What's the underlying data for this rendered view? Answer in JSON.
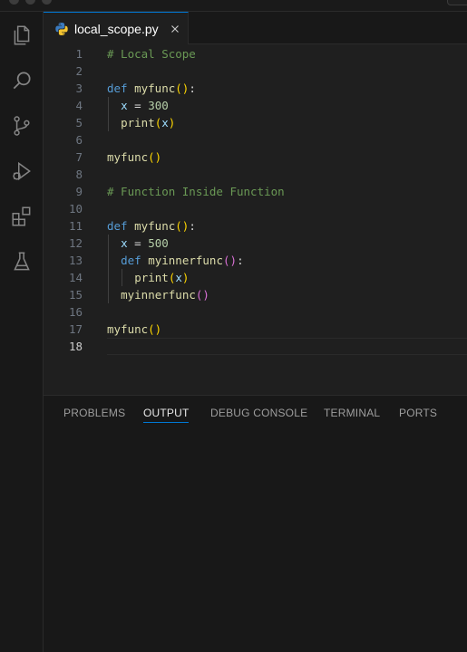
{
  "tab": {
    "filename": "local_scope.py",
    "icon": "python-icon"
  },
  "activity_bar": [
    {
      "name": "explorer-icon"
    },
    {
      "name": "search-icon"
    },
    {
      "name": "source-control-icon"
    },
    {
      "name": "run-debug-icon"
    },
    {
      "name": "extensions-icon"
    },
    {
      "name": "testing-icon"
    }
  ],
  "editor": {
    "active_line": "18",
    "lines": [
      {
        "n": "1",
        "tokens": [
          {
            "t": "# Local Scope",
            "c": "comment"
          }
        ]
      },
      {
        "n": "2",
        "tokens": []
      },
      {
        "n": "3",
        "tokens": [
          {
            "t": "def",
            "c": "kw"
          },
          {
            "t": " ",
            "c": "plain"
          },
          {
            "t": "myfunc",
            "c": "fn"
          },
          {
            "t": "()",
            "c": "paren"
          },
          {
            "t": ":",
            "c": "plain"
          }
        ]
      },
      {
        "n": "4",
        "indent": 1,
        "tokens": [
          {
            "t": "x",
            "c": "var"
          },
          {
            "t": " = ",
            "c": "op"
          },
          {
            "t": "300",
            "c": "num"
          }
        ]
      },
      {
        "n": "5",
        "indent": 1,
        "tokens": [
          {
            "t": "print",
            "c": "fn"
          },
          {
            "t": "(",
            "c": "paren"
          },
          {
            "t": "x",
            "c": "var"
          },
          {
            "t": ")",
            "c": "paren"
          }
        ]
      },
      {
        "n": "6",
        "tokens": []
      },
      {
        "n": "7",
        "tokens": [
          {
            "t": "myfunc",
            "c": "fn"
          },
          {
            "t": "()",
            "c": "paren"
          }
        ]
      },
      {
        "n": "8",
        "tokens": []
      },
      {
        "n": "9",
        "tokens": [
          {
            "t": "# Function Inside Function",
            "c": "comment"
          }
        ]
      },
      {
        "n": "10",
        "tokens": []
      },
      {
        "n": "11",
        "tokens": [
          {
            "t": "def",
            "c": "kw"
          },
          {
            "t": " ",
            "c": "plain"
          },
          {
            "t": "myfunc",
            "c": "fn"
          },
          {
            "t": "()",
            "c": "paren"
          },
          {
            "t": ":",
            "c": "plain"
          }
        ]
      },
      {
        "n": "12",
        "indent": 1,
        "tokens": [
          {
            "t": "x",
            "c": "var"
          },
          {
            "t": " = ",
            "c": "op"
          },
          {
            "t": "500",
            "c": "num"
          }
        ]
      },
      {
        "n": "13",
        "indent": 1,
        "tokens": [
          {
            "t": "def",
            "c": "kw"
          },
          {
            "t": " ",
            "c": "plain"
          },
          {
            "t": "myinnerfunc",
            "c": "fn"
          },
          {
            "t": "()",
            "c": "paren2"
          },
          {
            "t": ":",
            "c": "plain"
          }
        ]
      },
      {
        "n": "14",
        "indent": 2,
        "tokens": [
          {
            "t": "print",
            "c": "fn"
          },
          {
            "t": "(",
            "c": "paren"
          },
          {
            "t": "x",
            "c": "var"
          },
          {
            "t": ")",
            "c": "paren"
          }
        ]
      },
      {
        "n": "15",
        "indent": 1,
        "tokens": [
          {
            "t": "myinnerfunc",
            "c": "fn"
          },
          {
            "t": "()",
            "c": "paren2"
          }
        ]
      },
      {
        "n": "16",
        "tokens": []
      },
      {
        "n": "17",
        "tokens": [
          {
            "t": "myfunc",
            "c": "fn"
          },
          {
            "t": "()",
            "c": "paren"
          }
        ]
      },
      {
        "n": "18",
        "tokens": []
      }
    ]
  },
  "panel": {
    "tabs": [
      {
        "id": "problems",
        "label": "PROBLEMS"
      },
      {
        "id": "output",
        "label": "OUTPUT",
        "active": true
      },
      {
        "id": "debug-console",
        "label": "DEBUG CONSOLE"
      },
      {
        "id": "terminal",
        "label": "TERMINAL"
      },
      {
        "id": "ports",
        "label": "PORTS"
      }
    ]
  },
  "colors": {
    "accent": "#0078d4",
    "background": "#1f1f1f",
    "comment": "#6a9955",
    "keyword": "#569cd6",
    "function": "#dcdcaa",
    "number": "#b5cea8"
  }
}
